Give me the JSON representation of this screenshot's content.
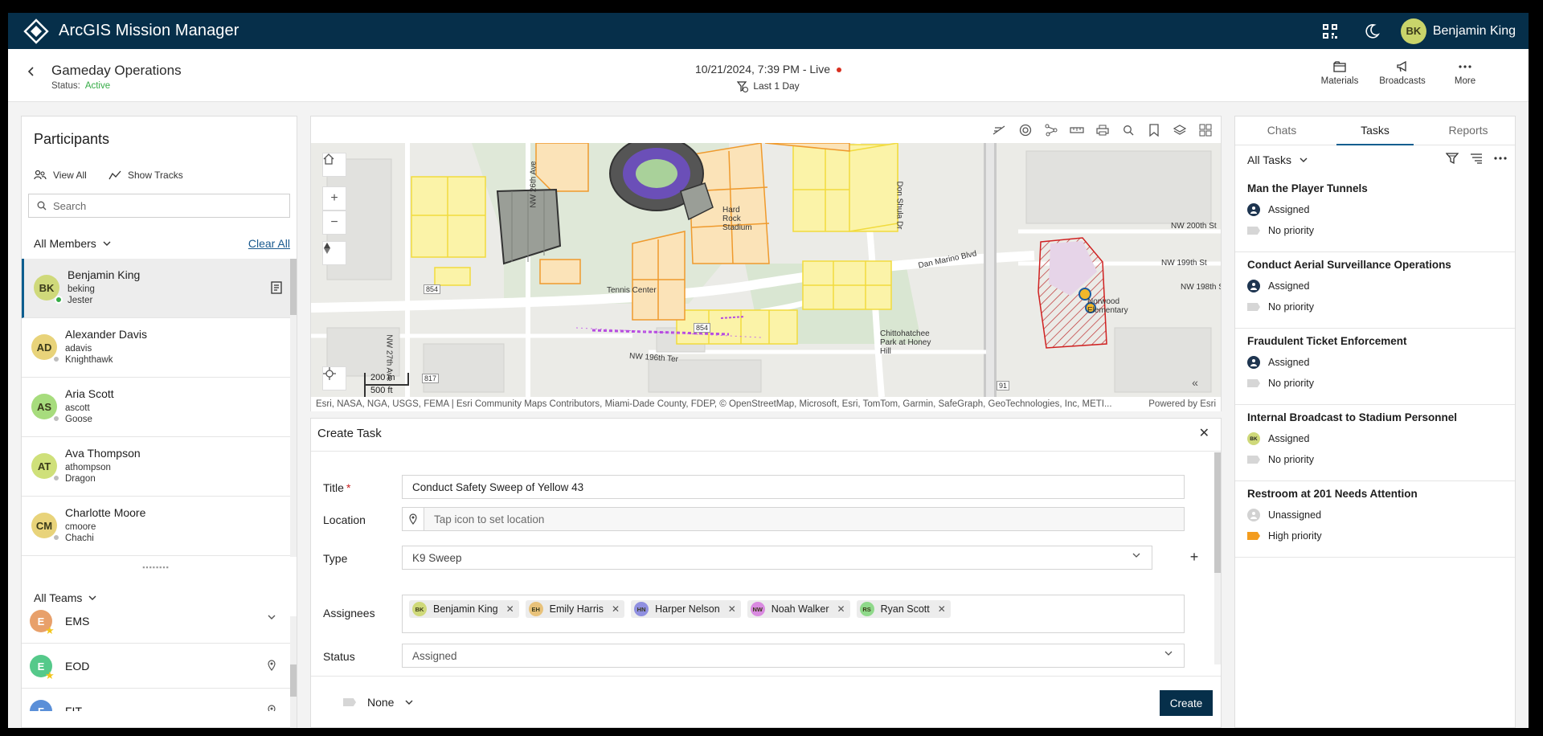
{
  "app": {
    "name": "ArcGIS Mission Manager",
    "user_initials": "BK",
    "user_name": "Benjamin King"
  },
  "header": {
    "title": "Gameday Operations",
    "status_label": "Status:",
    "status_value": "Active",
    "datetime": "10/21/2024, 7:39 PM - Live",
    "range": "Last 1 Day",
    "buttons": [
      "Materials",
      "Broadcasts",
      "More"
    ]
  },
  "participants": {
    "title": "Participants",
    "view_all": "View All",
    "show_tracks": "Show Tracks",
    "search_placeholder": "Search",
    "filter": "All Members",
    "clear_all": "Clear All",
    "members": [
      {
        "initials": "BK",
        "name": "Benjamin King",
        "username": "beking",
        "callsign": "Jester",
        "color": "#cfd97a"
      },
      {
        "initials": "AD",
        "name": "Alexander Davis",
        "username": "adavis",
        "callsign": "Knighthawk",
        "color": "#e8d37a"
      },
      {
        "initials": "AS",
        "name": "Aria Scott",
        "username": "ascott",
        "callsign": "Goose",
        "color": "#a7dc7d"
      },
      {
        "initials": "AT",
        "name": "Ava Thompson",
        "username": "athompson",
        "callsign": "Dragon",
        "color": "#cfe07a"
      },
      {
        "initials": "CM",
        "name": "Charlotte Moore",
        "username": "cmoore",
        "callsign": "Chachi",
        "color": "#e8d37a"
      }
    ],
    "teams_filter": "All Teams",
    "teams": [
      {
        "initial": "E",
        "name": "EMS",
        "color": "#e8a06a"
      },
      {
        "initial": "E",
        "name": "EOD",
        "color": "#55c98a"
      },
      {
        "initial": "F",
        "name": "FIT",
        "color": "#5a8fd8"
      }
    ]
  },
  "map": {
    "scale_m": "200 m",
    "scale_ft": "500 ft",
    "labels": [
      "Tennis Center",
      "Hard Rock Stadium",
      "Dan Marino Blvd",
      "NW 196th Ter",
      "Chittohatchee Park at Honey Hill",
      "Norwood Elementary",
      "NW 199th St",
      "NW 198th St",
      "NW 200th St",
      "Don Shula Dr",
      "NW 26th Ave",
      "NW 27th Ave",
      "854",
      "817",
      "91"
    ],
    "attribution": "Esri, NASA, NGA, USGS, FEMA | Esri Community Maps Contributors, Miami-Dade County, FDEP, © OpenStreetMap, Microsoft, Esri, TomTom, Garmin, SafeGraph, GeoTechnologies, Inc, METI...",
    "powered": "Powered by Esri"
  },
  "create_task": {
    "heading": "Create Task",
    "title_label": "Title",
    "title_value": "Conduct Safety Sweep of Yellow 43",
    "location_label": "Location",
    "location_placeholder": "Tap icon to set location",
    "type_label": "Type",
    "type_value": "K9 Sweep",
    "assignees_label": "Assignees",
    "assignees": [
      {
        "initials": "BK",
        "name": "Benjamin King",
        "color": "#cfd97a"
      },
      {
        "initials": "EH",
        "name": "Emily Harris",
        "color": "#e8c27a"
      },
      {
        "initials": "HN",
        "name": "Harper Nelson",
        "color": "#8f8fe0"
      },
      {
        "initials": "NW",
        "name": "Noah Walker",
        "color": "#d98ae0"
      },
      {
        "initials": "RS",
        "name": "Ryan Scott",
        "color": "#8fd98a"
      }
    ],
    "status_label": "Status",
    "status_value": "Assigned",
    "priority_value": "None",
    "create_button": "Create"
  },
  "right_panel": {
    "tabs": [
      "Chats",
      "Tasks",
      "Reports"
    ],
    "filter": "All Tasks",
    "tasks": [
      {
        "title": "Man the Player Tunnels",
        "status": "Assigned",
        "priority": "No priority",
        "icon": "group"
      },
      {
        "title": "Conduct Aerial Surveillance Operations",
        "status": "Assigned",
        "priority": "No priority",
        "icon": "group"
      },
      {
        "title": "Fraudulent Ticket Enforcement",
        "status": "Assigned",
        "priority": "No priority",
        "icon": "group"
      },
      {
        "title": "Internal Broadcast to Stadium Personnel",
        "status": "Assigned",
        "priority": "No priority",
        "icon": "BK"
      },
      {
        "title": "Restroom at 201 Needs Attention",
        "status": "Unassigned",
        "priority": "High priority",
        "icon": "none"
      }
    ]
  },
  "colors": {
    "topbar": "#062f4a",
    "active": "#35ac46",
    "live": "#d83020",
    "accent": "#0e5e8f",
    "high_priority": "#f39c1e"
  }
}
